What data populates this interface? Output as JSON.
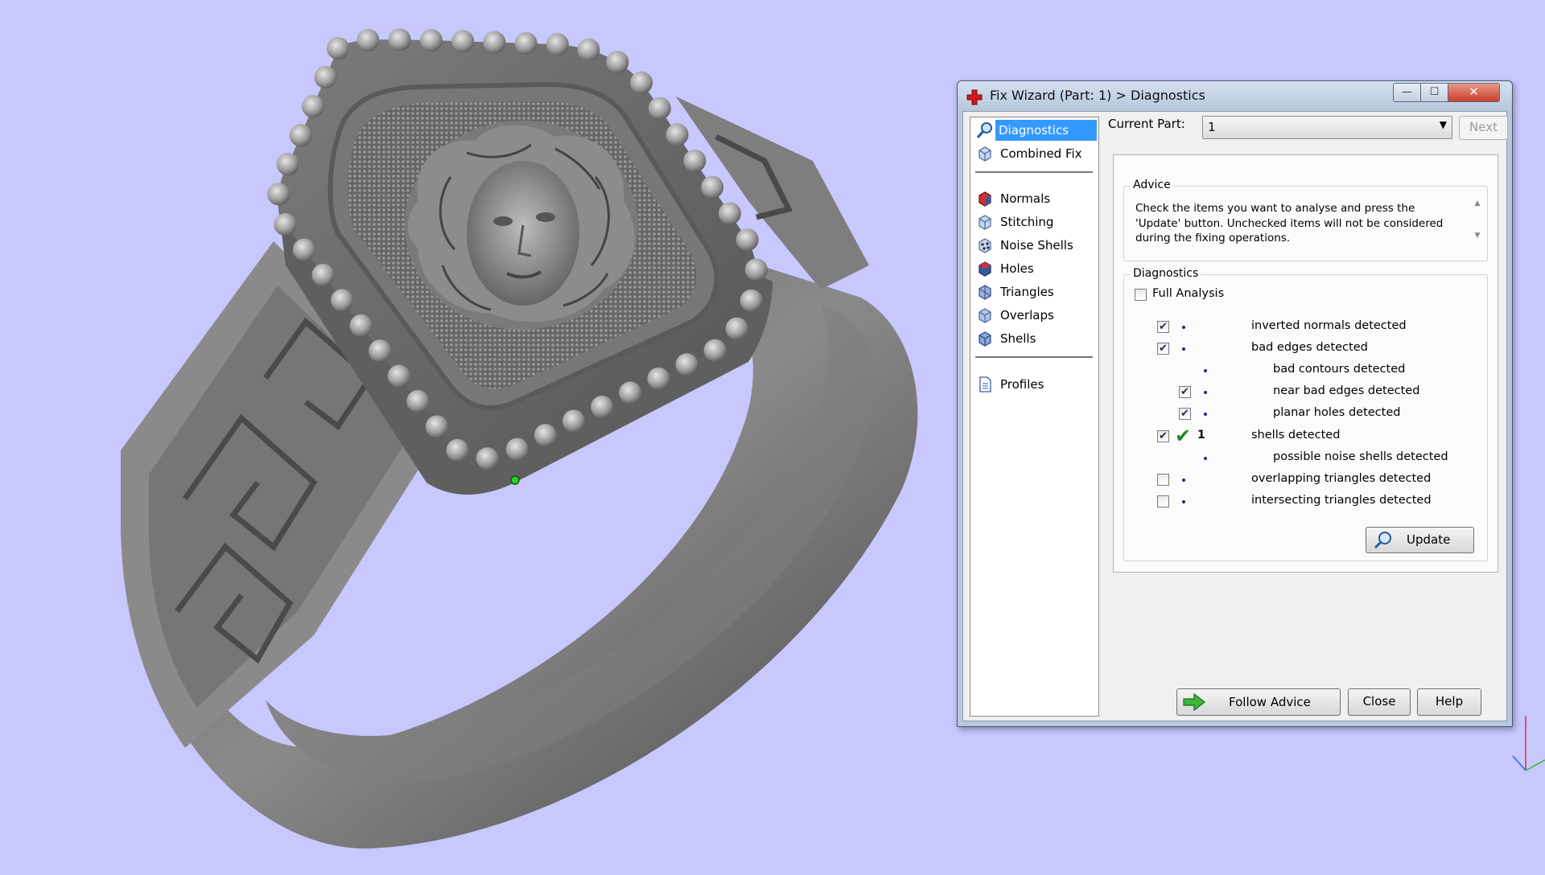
{
  "window": {
    "title": "Fix Wizard (Part: 1) > Diagnostics",
    "min_glyph": "—",
    "max_glyph": "☐",
    "close_glyph": "✕"
  },
  "nav": {
    "items": [
      {
        "label": "Diagnostics",
        "icon": "magnifier-icon",
        "active": true
      },
      {
        "label": "Combined Fix",
        "icon": "cube-icon"
      },
      {
        "label": "Normals",
        "icon": "red-cube-icon"
      },
      {
        "label": "Stitching",
        "icon": "cube-icon"
      },
      {
        "label": "Noise Shells",
        "icon": "dotted-cube-icon"
      },
      {
        "label": "Holes",
        "icon": "red-cube-icon"
      },
      {
        "label": "Triangles",
        "icon": "cube-icon"
      },
      {
        "label": "Overlaps",
        "icon": "cube-icon"
      },
      {
        "label": "Shells",
        "icon": "cube-icon"
      },
      {
        "label": "Profiles",
        "icon": "document-icon"
      }
    ]
  },
  "current_part": {
    "label": "Current Part:",
    "value": "1",
    "next_label": "Next"
  },
  "advice": {
    "title": "Advice",
    "text": "Check the items you want to analyse and press the 'Update' button. Unchecked items will not be considered during the fixing operations."
  },
  "diagnostics": {
    "title": "Diagnostics",
    "full_analysis_label": "Full Analysis",
    "full_analysis_checked": false,
    "rows": [
      {
        "label": "inverted normals detected",
        "checked": true,
        "has_checkbox": true,
        "indent": 0,
        "count": ""
      },
      {
        "label": "bad edges detected",
        "checked": true,
        "has_checkbox": true,
        "indent": 0,
        "count": ""
      },
      {
        "label": "bad contours detected",
        "checked": false,
        "has_checkbox": false,
        "indent": 1,
        "count": ""
      },
      {
        "label": "near bad edges detected",
        "checked": true,
        "has_checkbox": true,
        "indent": 1,
        "count": ""
      },
      {
        "label": "planar holes detected",
        "checked": true,
        "has_checkbox": true,
        "indent": 1,
        "count": ""
      },
      {
        "label": "shells detected",
        "checked": true,
        "has_checkbox": true,
        "indent": 0,
        "count": "1",
        "ok": true
      },
      {
        "label": "possible noise shells detected",
        "checked": false,
        "has_checkbox": false,
        "indent": 1,
        "count": ""
      },
      {
        "label": "overlapping triangles detected",
        "checked": false,
        "has_checkbox": true,
        "indent": 0,
        "count": ""
      },
      {
        "label": "intersecting triangles detected",
        "checked": false,
        "has_checkbox": true,
        "indent": 0,
        "count": ""
      }
    ],
    "update_label": "Update"
  },
  "footer": {
    "follow_advice_label": "Follow Advice",
    "close_label": "Close",
    "help_label": "Help"
  },
  "colors": {
    "background": "#c8c8ff",
    "selection": "#3399ff",
    "ok_check": "#1d8a24"
  }
}
